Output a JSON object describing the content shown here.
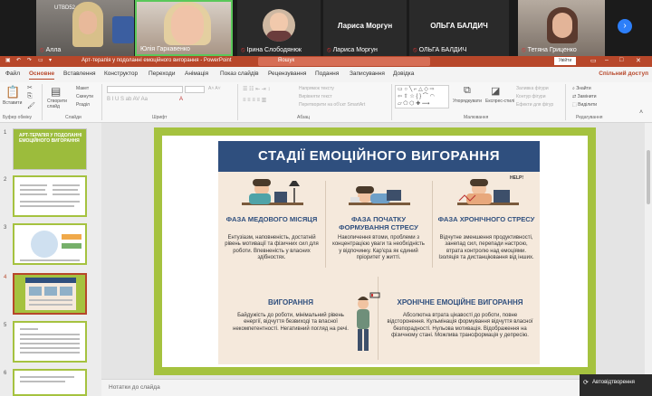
{
  "video": {
    "tiles": [
      {
        "name": "Алла",
        "logo": "UTBD52"
      },
      {
        "name": "Юлія Гаркавенко"
      },
      {
        "name": "Ірина Слободянюк"
      },
      {
        "name": "Лариса Моргун",
        "big": "Лариса Моргун"
      },
      {
        "name": "ОЛЬГА БАЛДИЧ",
        "big": "ОЛЬГА БАЛДИЧ"
      },
      {
        "name": "Тетяна Гриценко"
      }
    ],
    "next_icon": "›"
  },
  "titlebar": {
    "doc_title": "Арт-терапія у подоланні емоційного вигорання - PowerPoint",
    "search_placeholder": "Пошук",
    "login": "Увійти"
  },
  "tabs": [
    "Файл",
    "Основне",
    "Вставлення",
    "Конструктор",
    "Переходи",
    "Анімація",
    "Показ слайдів",
    "Рецензування",
    "Подання",
    "Записування",
    "Довідка"
  ],
  "share": "Спільний доступ",
  "ribbon": {
    "clipboard": {
      "label": "Буфер обміну",
      "paste": "Вставити"
    },
    "slides": {
      "label": "Слайди",
      "new": "Створити слайд",
      "layout": "Макет",
      "reset": "Скинути",
      "section": "Розділ"
    },
    "font": {
      "label": "Шрифт"
    },
    "paragraph": {
      "label": "Абзац",
      "direction": "Напрямок тексту",
      "align": "Вирівняти текст",
      "smartart": "Перетворити на об'єкт SmartArt"
    },
    "drawing": {
      "label": "Малювання",
      "arrange": "Упорядкувати",
      "styles": "Експрес-стилі",
      "fill": "Заливка фігури",
      "outline": "Контур фігури",
      "effects": "Ефекти для фігур"
    },
    "editing": {
      "label": "Редагування",
      "find": "Знайти",
      "replace": "Замінити",
      "select": "Виділити"
    }
  },
  "thumbnails": {
    "numbers": [
      "1",
      "2",
      "3",
      "4",
      "5",
      "6"
    ],
    "slide1_title": "АРТ-ТЕРАПІЯ У ПОДОЛАННІ ЕМОЦІЙНОГО ВИГОРАННЯ"
  },
  "slide": {
    "title": "СТАДІЇ ЕМОЦІЙНОГО ВИГОРАННЯ",
    "help": "HELP!",
    "phases": [
      {
        "title": "ФАЗА МЕДОВОГО МІСЯЦЯ",
        "text": "Ентузіазм, наповненість, достатній рівень мотивації та фізичних сил для роботи. Впевненість у власних здібностях."
      },
      {
        "title": "ФАЗА ПОЧАТКУ ФОРМУВАННЯ СТРЕСУ",
        "text": "Накопичення втоми, проблеми з концентрацією уваги та необхідність у відпочинку. Кар'єра як єдиний пріоритет у житті."
      },
      {
        "title": "ФАЗА ХРОНІЧНОГО СТРЕСУ",
        "text": "Відчутне зменшення продуктивності, занепад сил, перепади настрою, втрата контролю над емоціями. Ізоляція та дистанціювання від інших."
      },
      {
        "title": "ВИГОРАННЯ",
        "text": "Байдужість до роботи, мінімальний рівень енергії, відчуття безвиході та власної некомпетентності. Негативний погляд на речі."
      },
      {
        "title": "ХРОНІЧНЕ ЕМОЦІЙНЕ ВИГОРАННЯ",
        "text": "Абсолютна втрата цікавості до роботи, повне відсторонення. Кульмінація формування відчуття власної безпорадності. Нульова мотивація. Відображення на фізичному стані. Можлива трансформація у депресію."
      }
    ]
  },
  "notes": "Нотатки до слайда",
  "autorecover": "Автовідтворення",
  "colors": {
    "accent": "#b7472a",
    "slide_green": "#a5c23f",
    "navy": "#2f4f7e",
    "beige": "#f5e9dc"
  }
}
